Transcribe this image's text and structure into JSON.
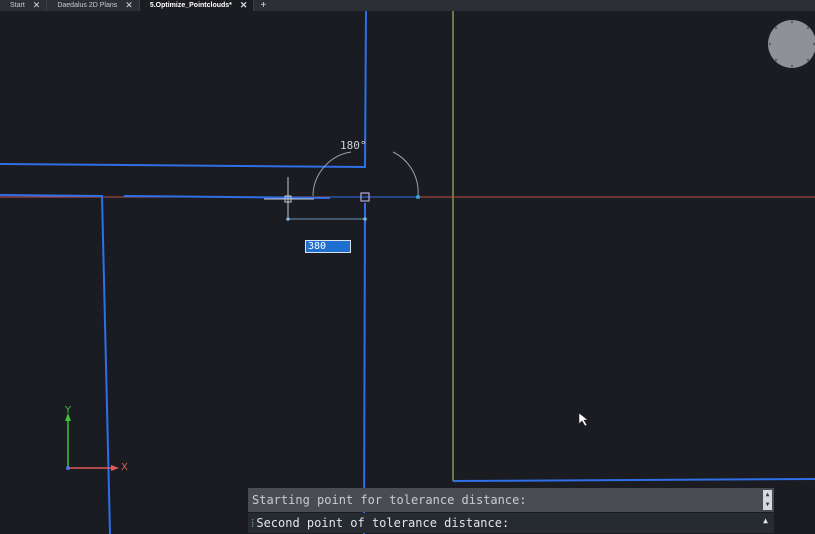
{
  "tabs": [
    {
      "label": "Start",
      "active": false
    },
    {
      "label": "Daedalus 2D Plans",
      "active": false
    },
    {
      "label": "5.Optimize_Pointclouds*",
      "active": true
    }
  ],
  "tab_close_glyph": "✕",
  "tab_add_glyph": "+",
  "dimension": {
    "input_value": "380",
    "angle_label": "180°"
  },
  "ucs": {
    "x_label": "X",
    "y_label": "Y"
  },
  "command_line": {
    "history": "Starting point for tolerance distance:",
    "prompt": "Second point of tolerance distance:"
  },
  "colors": {
    "background": "#1a1c21",
    "wall": "#2f6fe8",
    "guide_green": "#b8d46a",
    "guide_red": "#c0504d",
    "dim_input": "#1e6fd0"
  },
  "icons": [
    "close-icon",
    "plus-icon",
    "navigation-wheel-icon",
    "ucs-axis-icon",
    "cursor-arrow-icon",
    "scroll-arrow-icon",
    "crosshair-cursor-icon",
    "snap-marker-icon"
  ]
}
